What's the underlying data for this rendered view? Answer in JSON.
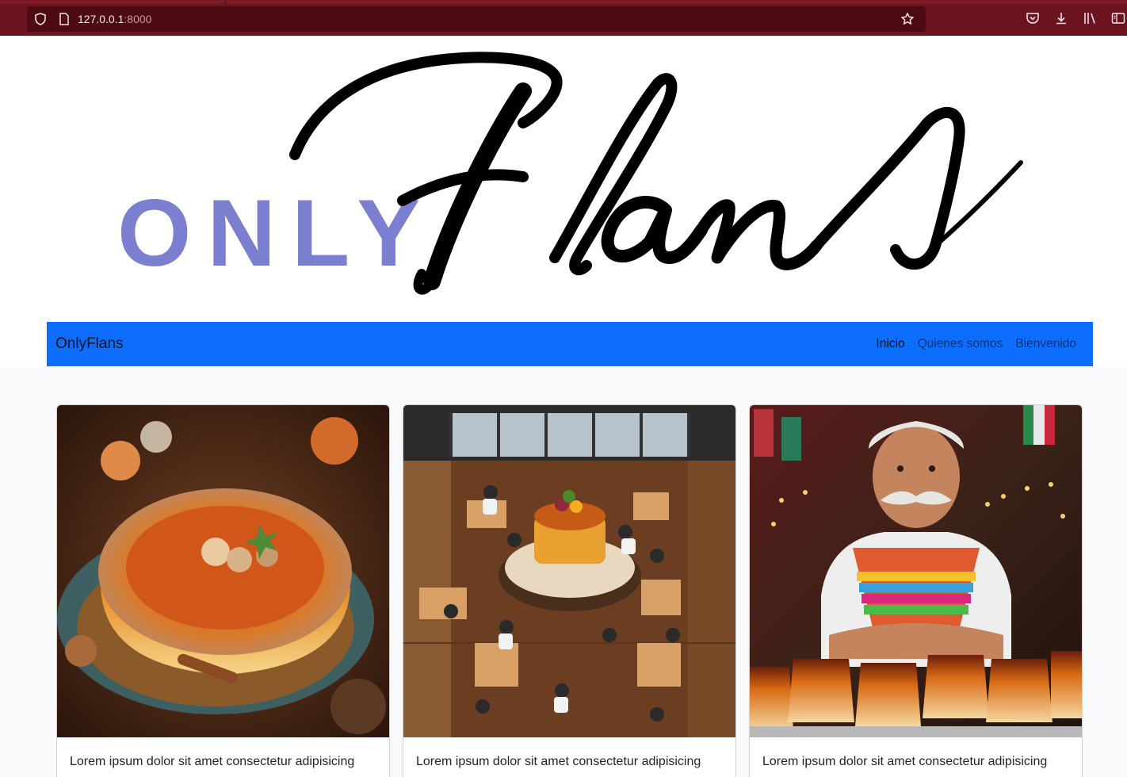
{
  "browser": {
    "url_host": "127.0.0.1",
    "url_port": ":8000"
  },
  "logo": {
    "prefix": "ONLY",
    "script": "Flans",
    "prefix_color": "#7b7fcf"
  },
  "navbar": {
    "brand": "OnlyFlans",
    "background": "#0d6efd",
    "links": [
      {
        "label": "Inicio",
        "active": true
      },
      {
        "label": "Quienes somos",
        "active": false
      },
      {
        "label": "Bienvenido",
        "active": false
      }
    ]
  },
  "cards": [
    {
      "image": "caramel-flan-photo",
      "text": "Lorem ipsum dolor sit amet consectetur adipisicing"
    },
    {
      "image": "restaurant-aerial-photo",
      "text": "Lorem ipsum dolor sit amet consectetur adipisicing"
    },
    {
      "image": "flan-chef-photo",
      "text": "Lorem ipsum dolor sit amet consectetur adipisicing"
    }
  ]
}
